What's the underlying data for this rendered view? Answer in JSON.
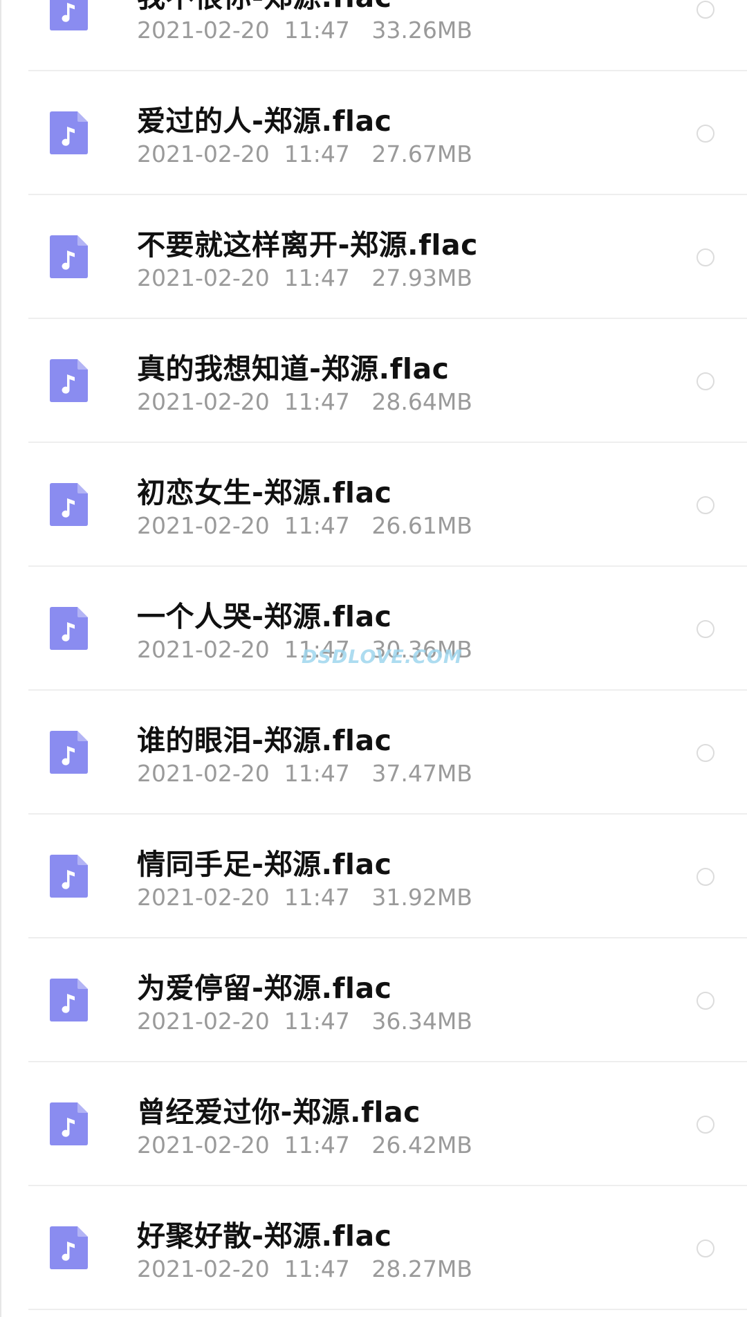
{
  "watermark": "DSDLOVE.COM",
  "icon": "music-file-icon",
  "colors": {
    "icon_bg": "#8a8cf0",
    "title": "#111111",
    "meta": "#9a9a9a",
    "divider": "#eeeeee"
  },
  "files": [
    {
      "name": "我不恨你-郑源.flac",
      "date": "2021-02-20",
      "time": "11:47",
      "size": "33.26MB"
    },
    {
      "name": "爱过的人-郑源.flac",
      "date": "2021-02-20",
      "time": "11:47",
      "size": "27.67MB"
    },
    {
      "name": "不要就这样离开-郑源.flac",
      "date": "2021-02-20",
      "time": "11:47",
      "size": "27.93MB"
    },
    {
      "name": "真的我想知道-郑源.flac",
      "date": "2021-02-20",
      "time": "11:47",
      "size": "28.64MB"
    },
    {
      "name": "初恋女生-郑源.flac",
      "date": "2021-02-20",
      "time": "11:47",
      "size": "26.61MB"
    },
    {
      "name": "一个人哭-郑源.flac",
      "date": "2021-02-20",
      "time": "11:47",
      "size": "30.36MB"
    },
    {
      "name": "谁的眼泪-郑源.flac",
      "date": "2021-02-20",
      "time": "11:47",
      "size": "37.47MB"
    },
    {
      "name": "情同手足-郑源.flac",
      "date": "2021-02-20",
      "time": "11:47",
      "size": "31.92MB"
    },
    {
      "name": "为爱停留-郑源.flac",
      "date": "2021-02-20",
      "time": "11:47",
      "size": "36.34MB"
    },
    {
      "name": "曾经爱过你-郑源.flac",
      "date": "2021-02-20",
      "time": "11:47",
      "size": "26.42MB"
    },
    {
      "name": "好聚好散-郑源.flac",
      "date": "2021-02-20",
      "time": "11:47",
      "size": "28.27MB"
    }
  ]
}
